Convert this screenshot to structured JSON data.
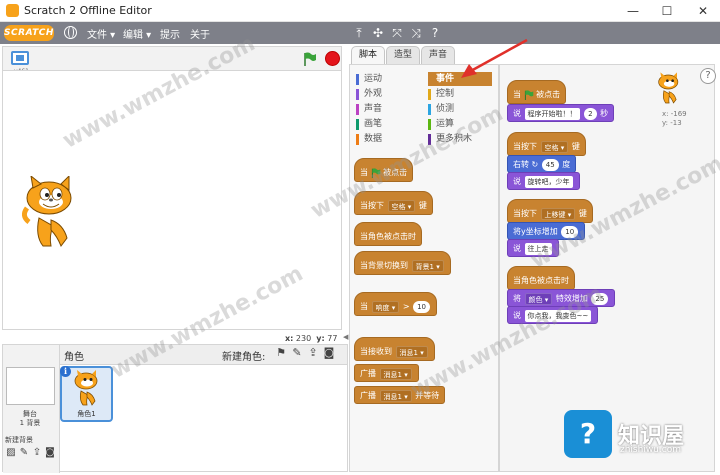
{
  "window": {
    "title": "Scratch 2 Offline Editor",
    "minimize": "—",
    "maximize": "☐",
    "close": "✕"
  },
  "menubar": {
    "logo": "SCRATCH",
    "items": [
      {
        "label": "文件 ▾"
      },
      {
        "label": "编辑 ▾"
      },
      {
        "label": "提示"
      },
      {
        "label": "关于"
      }
    ],
    "tools": [
      "⤒",
      "✣",
      "⤧",
      "⤨",
      "?"
    ]
  },
  "stage": {
    "version": "v461",
    "x_label": "x:",
    "x_value": "230",
    "y_label": "y:",
    "y_value": "77"
  },
  "sprites": {
    "title": "角色",
    "new_sprite_label": "新建角色:",
    "stage_label": "舞台",
    "stage_bg_count": "1 背景",
    "new_bg_label": "新建背景",
    "sprite_name": "角色1",
    "info": "i"
  },
  "tabs": [
    {
      "label": "脚本",
      "active": true
    },
    {
      "label": "造型",
      "active": false
    },
    {
      "label": "声音",
      "active": false
    }
  ],
  "categories": [
    {
      "label": "运动",
      "color": "#4a6cd4"
    },
    {
      "label": "事件",
      "color": "#c88330",
      "active": true
    },
    {
      "label": "外观",
      "color": "#8a55d7"
    },
    {
      "label": "控制",
      "color": "#e1a91a"
    },
    {
      "label": "声音",
      "color": "#bb42c3"
    },
    {
      "label": "侦测",
      "color": "#2ca5e2"
    },
    {
      "label": "画笔",
      "color": "#0e9a6c"
    },
    {
      "label": "运算",
      "color": "#5cb712"
    },
    {
      "label": "数据",
      "color": "#ee7d16"
    },
    {
      "label": "更多积木",
      "color": "#632d99"
    }
  ],
  "palette_blocks": {
    "when_flag": {
      "pre": "当",
      "post": "被点击"
    },
    "when_key": {
      "pre": "当按下",
      "drop": "空格 ▾",
      "post": "键"
    },
    "when_sprite_clicked": "当角色被点击时",
    "when_bg_switch": {
      "pre": "当背景切换到",
      "drop": "背景1 ▾"
    },
    "when_gt": {
      "pre": "当",
      "drop": "响度 ▾",
      "op": ">",
      "value": "10"
    },
    "when_receive": {
      "pre": "当接收到",
      "drop": "消息1 ▾"
    },
    "broadcast": {
      "pre": "广播",
      "drop": "消息1 ▾"
    },
    "broadcast_wait": {
      "pre": "广播",
      "drop": "消息1 ▾",
      "post": "并等待"
    }
  },
  "scripts": {
    "sprite_x": "x: -169",
    "sprite_y": "y: -13",
    "s1_hat": {
      "pre": "当",
      "post": "被点击"
    },
    "s1_say": {
      "pre": "说",
      "text": "程序开始啦！！",
      "value": "2",
      "post": "秒"
    },
    "s2_hat": {
      "pre": "当按下",
      "drop": "空格 ▾",
      "post": "键"
    },
    "s2_turn": {
      "pre": "右转",
      "icon": "↻",
      "value": "45",
      "post": "度"
    },
    "s2_say": {
      "pre": "说",
      "text": "旋转吧，少年"
    },
    "s3_hat": {
      "pre": "当按下",
      "drop": "上移键 ▾",
      "post": "键"
    },
    "s3_move": {
      "pre": "将y坐标增加",
      "value": "10"
    },
    "s3_say": {
      "pre": "说",
      "text": "往上走"
    },
    "s4_hat": "当角色被点击时",
    "s4_effect": {
      "pre": "将",
      "drop": "颜色 ▾",
      "mid": "特效增加",
      "value": "25"
    },
    "s4_say": {
      "pre": "说",
      "text": "你点我，我变色~~"
    }
  },
  "watermark": "www.wmzhe.com",
  "brand": {
    "icon": "?",
    "name": "知识屋",
    "url": "zhishiwu.com"
  },
  "colors": {
    "events": "#c88330",
    "looks": "#8a55d7",
    "motion": "#4a6cd4",
    "menubar": "#7e8089",
    "stop": "#e4141b",
    "flag": "#3aa33a"
  }
}
